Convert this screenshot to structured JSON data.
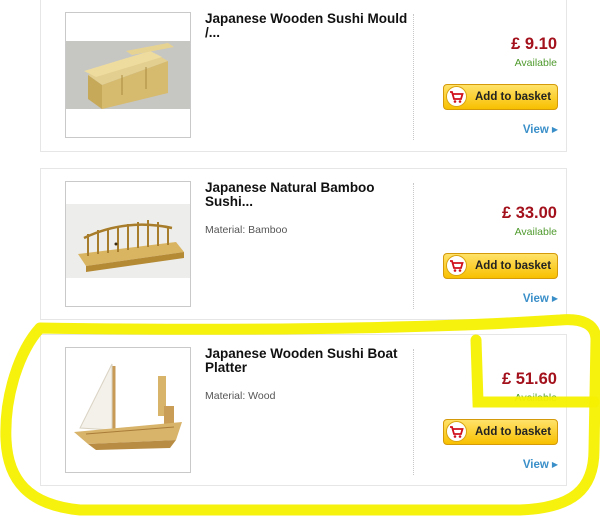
{
  "products": [
    {
      "title": "Japanese Wooden Sushi Mould /...",
      "material": "",
      "price": "£ 9.10",
      "availability": "Available",
      "basket_label": "Add to basket",
      "view_label": "View",
      "image": "sushi-mould-image"
    },
    {
      "title": "Japanese Natural Bamboo Sushi...",
      "material": "Material: Bamboo",
      "price": "£ 33.00",
      "availability": "Available",
      "basket_label": "Add to basket",
      "view_label": "View",
      "image": "bamboo-bridge-image"
    },
    {
      "title": "Japanese Wooden Sushi Boat Platter",
      "material": "Material: Wood",
      "price": "£ 51.60",
      "availability": "Available",
      "basket_label": "Add to basket",
      "view_label": "View",
      "image": "sushi-boat-image"
    }
  ],
  "colors": {
    "price": "#a3111c",
    "available": "#4f9a2d",
    "button": "#f8c000",
    "link": "#3a8fc9",
    "highlight": "#f5f000"
  }
}
